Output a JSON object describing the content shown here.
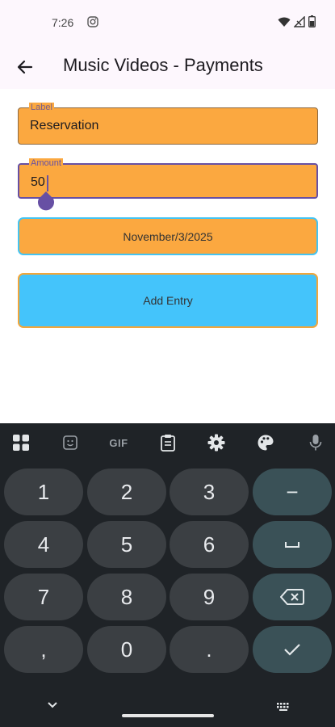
{
  "status": {
    "time": "7:26"
  },
  "appbar": {
    "title": "Music Videos - Payments"
  },
  "form": {
    "label_field": {
      "label": "Label",
      "value": "Reservation"
    },
    "amount_field": {
      "label": "Amount",
      "value": "50"
    },
    "date_button": "November/3/2025",
    "add_button": "Add Entry"
  },
  "keyboard": {
    "toolbar": {
      "gif": "GIF"
    },
    "keys": {
      "k1": "1",
      "k2": "2",
      "k3": "3",
      "minus": "−",
      "k4": "4",
      "k5": "5",
      "k6": "6",
      "k7": "7",
      "k8": "8",
      "k9": "9",
      "comma": ",",
      "k0": "0",
      "period": "."
    }
  },
  "colors": {
    "field_bg": "#fba840",
    "focus_border": "#6750a4",
    "add_button_bg": "#44c4fb",
    "keyboard_bg": "#1f2327",
    "key_bg": "#3b3f43",
    "function_key_bg": "#3a5157"
  }
}
